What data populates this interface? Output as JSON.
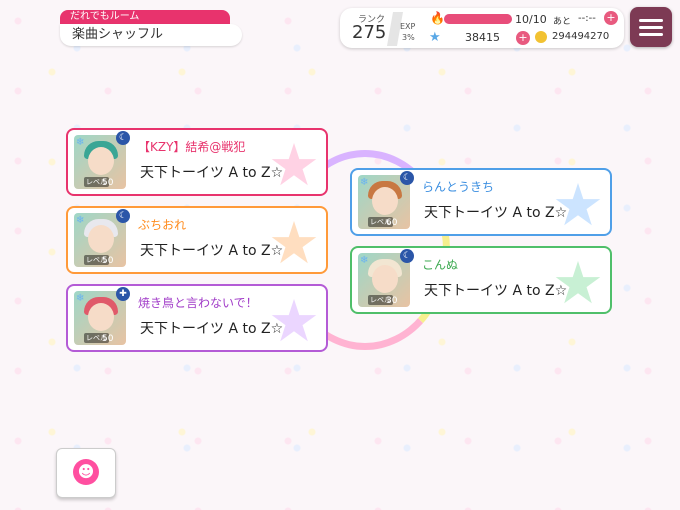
{
  "room": {
    "type_label": "だれでもルーム",
    "name": "楽曲シャッフル"
  },
  "status": {
    "rank_label": "ランク",
    "rank": "275",
    "exp_label": "EXP",
    "exp_percent": "3%",
    "stamina": "10/10",
    "stamina_fraction": 1.0,
    "stamina_next_label": "あと",
    "stamina_timer": "--:--",
    "stars": "38415",
    "coins": "294494270"
  },
  "icons": {
    "menu": "menu-icon",
    "plus": "+",
    "flame": "🔥",
    "star": "★",
    "emote": "☻"
  },
  "players": [
    {
      "name": "【KZY】結希@戦犯",
      "song": "天下トーイツ A to Z☆",
      "level_label": "レベル",
      "level": "50",
      "name_color": "#e8336d",
      "border": "#e8336d",
      "star_color": "#ff7eb3",
      "hair": "#3aa695"
    },
    {
      "name": "ぶちおれ",
      "song": "天下トーイツ A to Z☆",
      "level_label": "レベル",
      "level": "50",
      "name_color": "#ff8a1a",
      "border": "#ff9a3a",
      "star_color": "#ffa24a",
      "hair": "#e8e8ee"
    },
    {
      "name": "焼き鳥と言わないで！",
      "song": "天下トーイツ A to Z☆",
      "level_label": "レベル",
      "level": "50",
      "name_color": "#a13cc8",
      "border": "#b45bd6",
      "star_color": "#c58bff",
      "hair": "#e05a6a"
    },
    {
      "name": "らんとうきち",
      "song": "天下トーイツ A to Z☆",
      "level_label": "レベル",
      "level": "60",
      "name_color": "#3a8ee0",
      "border": "#4f9fe8",
      "star_color": "#6db2ff",
      "hair": "#c87842"
    },
    {
      "name": "こんぬ",
      "song": "天下トーイツ A to Z☆",
      "level_label": "レベル",
      "level": "30",
      "name_color": "#3eaa52",
      "border": "#4fbf6a",
      "star_color": "#63d483",
      "hair": "#f2e6d2"
    }
  ]
}
